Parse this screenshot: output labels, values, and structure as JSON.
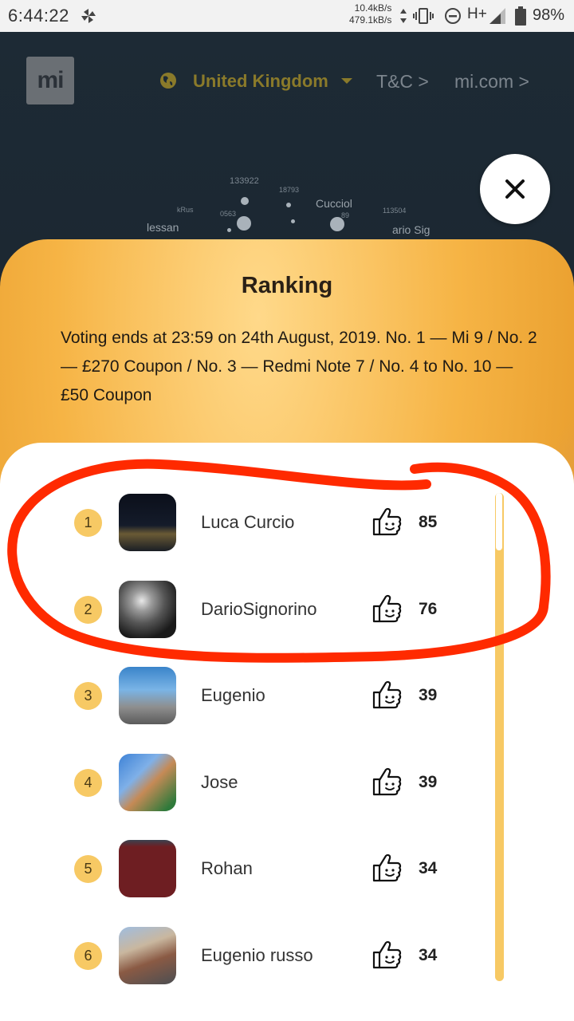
{
  "status_bar": {
    "time": "6:44:22",
    "net_up": "10.4kB/s",
    "net_down": "479.1kB/s",
    "network": "H+",
    "battery": "98%"
  },
  "nav": {
    "country": "United Kingdom",
    "tc_link": "T&C >",
    "mi_link": "mi.com >",
    "logo_text": "mi"
  },
  "background_bubbles": {
    "texts": [
      "133922",
      "18793",
      "Cucciol",
      "lessan",
      "kRus",
      "0563",
      "89",
      "113504",
      "ario Sig"
    ]
  },
  "modal": {
    "title": "Ranking",
    "description": "Voting ends at 23:59 on 24th August, 2019. No. 1 — Mi 9 / No. 2 — £270 Coupon / No. 3 — Redmi Note 7 / No. 4 to No. 10 — £50 Coupon"
  },
  "ranking": [
    {
      "rank": "1",
      "name": "Luca Curcio",
      "votes": "85"
    },
    {
      "rank": "2",
      "name": "DarioSignorino",
      "votes": "76"
    },
    {
      "rank": "3",
      "name": "Eugenio",
      "votes": "39"
    },
    {
      "rank": "4",
      "name": "Jose",
      "votes": "39"
    },
    {
      "rank": "5",
      "name": "Rohan",
      "votes": "34"
    },
    {
      "rank": "6",
      "name": "Eugenio russo",
      "votes": "34"
    }
  ],
  "colors": {
    "accent_yellow": "#f7c964",
    "annotation_red": "#ff2a00"
  }
}
